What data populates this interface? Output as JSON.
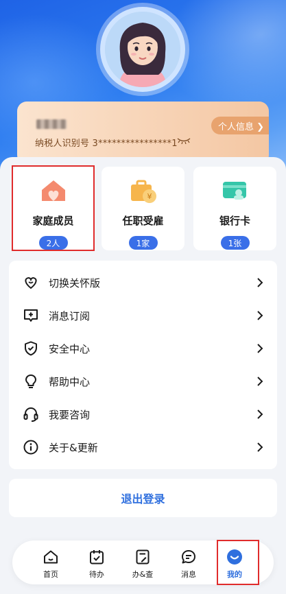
{
  "profile": {
    "tax_id_label": "纳税人识别号 3****************1",
    "personal_info_button": "个人信息 ❯"
  },
  "tiles": [
    {
      "label": "家庭成员",
      "badge": "2人",
      "icon": "family-house-heart-icon"
    },
    {
      "label": "任职受雇",
      "badge": "1家",
      "icon": "briefcase-yen-icon"
    },
    {
      "label": "银行卡",
      "badge": "1张",
      "icon": "bank-card-icon"
    }
  ],
  "menu": [
    {
      "label": "切换关怀版",
      "icon": "heart-outline-icon"
    },
    {
      "label": "消息订阅",
      "icon": "message-plus-icon"
    },
    {
      "label": "安全中心",
      "icon": "shield-check-icon"
    },
    {
      "label": "帮助中心",
      "icon": "lightbulb-icon"
    },
    {
      "label": "我要咨询",
      "icon": "headset-icon"
    },
    {
      "label": "关于&更新",
      "icon": "info-circle-icon"
    }
  ],
  "logout_label": "退出登录",
  "tabbar": [
    {
      "label": "首页",
      "icon": "home-icon"
    },
    {
      "label": "待办",
      "icon": "calendar-check-icon"
    },
    {
      "label": "办&查",
      "icon": "document-edit-icon"
    },
    {
      "label": "消息",
      "icon": "chat-bubble-icon"
    },
    {
      "label": "我的",
      "icon": "profile-smile-icon",
      "active": true
    }
  ],
  "colors": {
    "accent": "#2f6fde",
    "badge": "#3a6fe8",
    "highlight": "#e02b2b"
  }
}
